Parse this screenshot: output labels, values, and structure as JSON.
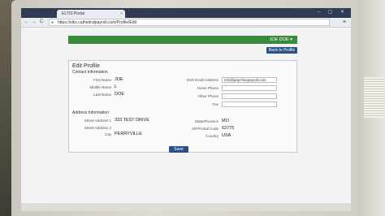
{
  "browser": {
    "tab_title": "ELTIS Portal",
    "tab_close": "×",
    "window_controls": "– ▢ ✕",
    "url": "https://eltis.cathedralpayroll.com/Profile/Edit",
    "nav_back": "←",
    "nav_forward": "→",
    "nav_reload": "C",
    "menu": "≡"
  },
  "header": {
    "user_menu": "JOE DOE ▾",
    "back_button": "Back to Profile"
  },
  "form": {
    "title": "Edit Profile",
    "contact_section": "Contact Information",
    "address_section": "Address Information",
    "first_name": {
      "label": "First Name",
      "value": "JOE"
    },
    "middle_name": {
      "label": "Middle Name",
      "value": "L"
    },
    "last_name": {
      "label": "Last Name",
      "value": "DOE"
    },
    "email": {
      "label": "ESS Email Address",
      "value": "info@paychexpayroll.com"
    },
    "home_phone": {
      "label": "Home Phone",
      "value": ""
    },
    "other_phone": {
      "label": "Other Phone",
      "value": ""
    },
    "fax": {
      "label": "Fax",
      "value": ""
    },
    "street1": {
      "label": "Street Address 1",
      "value": "333 TEST DRIVE"
    },
    "street2": {
      "label": "Street Address 2",
      "value": ""
    },
    "city": {
      "label": "City",
      "value": "PERRYVILLE"
    },
    "state": {
      "label": "State/Province",
      "value": "MO"
    },
    "zip": {
      "label": "ZIP/Postal Code",
      "value": "63775"
    },
    "country": {
      "label": "Country",
      "value": "USA"
    },
    "save_button": "Save"
  }
}
